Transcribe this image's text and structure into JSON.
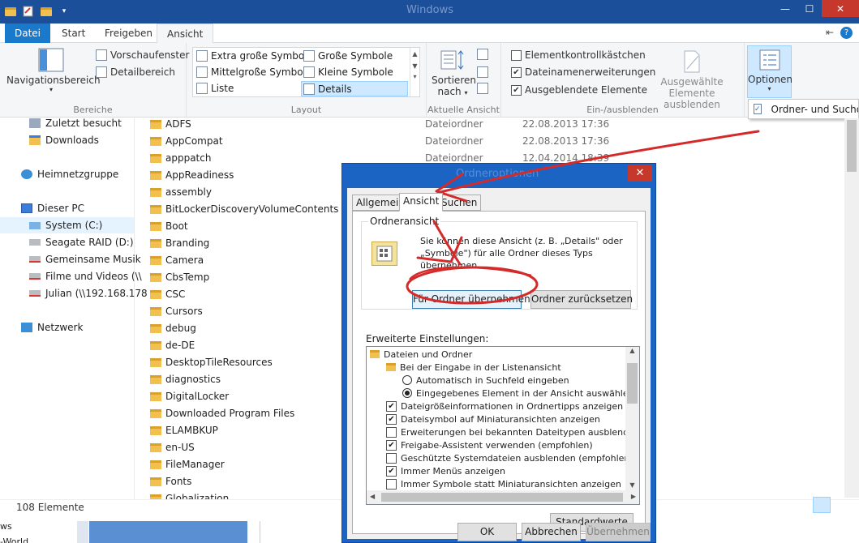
{
  "window": {
    "title": "Windows",
    "controls": {
      "minimize": "—",
      "maximize": "☐",
      "close": "✕"
    }
  },
  "ribbon": {
    "tabs": [
      {
        "label": "Datei"
      },
      {
        "label": "Start"
      },
      {
        "label": "Freigeben"
      },
      {
        "label": "Ansicht"
      }
    ],
    "groups": {
      "bereiche": {
        "label": "Bereiche",
        "navigationsbereich": "Navigationsbereich",
        "vorschaufenster": "Vorschaufenster",
        "detailbereich": "Detailbereich"
      },
      "layout": {
        "label": "Layout",
        "items": [
          "Extra große Symbole",
          "Große Symbole",
          "Mittelgroße Symbole",
          "Kleine Symbole",
          "Liste",
          "Details"
        ]
      },
      "aktuelle_ansicht": {
        "label": "Aktuelle Ansicht",
        "sortieren": "Sortieren",
        "nach": "nach"
      },
      "ein_ausblenden": {
        "label": "Ein-/ausblenden",
        "elementkontrollkaestchen": "Elementkontrollkästchen",
        "dateinamenerweiterungen": "Dateinamenerweiterungen",
        "ausgeblendete_elemente": "Ausgeblendete Elemente",
        "ausgewaehlte_line1": "Ausgewählte",
        "ausgewaehlte_line2": "Elemente ausblenden"
      },
      "optionen": {
        "label": "Optionen"
      }
    },
    "options_menu_item": "Ordner- und Suchop"
  },
  "nav": {
    "items": [
      {
        "label": "Zuletzt besucht",
        "icon": "recent-icon"
      },
      {
        "label": "Downloads",
        "icon": "downloads-icon"
      },
      {
        "label": "Heimnetzgruppe",
        "icon": "homegroup-icon"
      },
      {
        "label": "Dieser PC",
        "icon": "computer-icon"
      },
      {
        "label": "System (C:)",
        "icon": "drive-icon"
      },
      {
        "label": "Seagate RAID (D:)",
        "icon": "drive-icon"
      },
      {
        "label": "Gemeinsame Musik",
        "icon": "network-drive-icon"
      },
      {
        "label": "Filme und Videos (\\\\",
        "icon": "network-drive-icon"
      },
      {
        "label": "Julian (\\\\192.168.178",
        "icon": "network-drive-icon"
      },
      {
        "label": "Netzwerk",
        "icon": "network-icon"
      }
    ]
  },
  "files": [
    {
      "name": "ADFS",
      "type": "Dateiordner",
      "date": "22.08.2013 17:36"
    },
    {
      "name": "AppCompat",
      "type": "Dateiordner",
      "date": "22.08.2013 17:36"
    },
    {
      "name": "apppatch",
      "type": "Dateiordner",
      "date": "12.04.2014 18:39"
    },
    {
      "name": "AppReadiness",
      "type": "",
      "date": ""
    },
    {
      "name": "assembly",
      "type": "",
      "date": ""
    },
    {
      "name": "BitLockerDiscoveryVolumeContents",
      "type": "",
      "date": ""
    },
    {
      "name": "Boot",
      "type": "",
      "date": ""
    },
    {
      "name": "Branding",
      "type": "",
      "date": ""
    },
    {
      "name": "Camera",
      "type": "",
      "date": ""
    },
    {
      "name": "CbsTemp",
      "type": "",
      "date": ""
    },
    {
      "name": "CSC",
      "type": "",
      "date": ""
    },
    {
      "name": "Cursors",
      "type": "",
      "date": ""
    },
    {
      "name": "debug",
      "type": "",
      "date": ""
    },
    {
      "name": "de-DE",
      "type": "",
      "date": ""
    },
    {
      "name": "DesktopTileResources",
      "type": "",
      "date": ""
    },
    {
      "name": "diagnostics",
      "type": "",
      "date": ""
    },
    {
      "name": "DigitalLocker",
      "type": "",
      "date": ""
    },
    {
      "name": "Downloaded Program Files",
      "type": "",
      "date": ""
    },
    {
      "name": "ELAMBKUP",
      "type": "",
      "date": ""
    },
    {
      "name": "en-US",
      "type": "",
      "date": ""
    },
    {
      "name": "FileManager",
      "type": "",
      "date": ""
    },
    {
      "name": "Fonts",
      "type": "",
      "date": ""
    },
    {
      "name": "Globalization",
      "type": "",
      "date": ""
    }
  ],
  "status": {
    "count": "108 Elemente"
  },
  "bottom": {
    "line1": "ws",
    "line2": "-World"
  },
  "dialog": {
    "title": "Ordneroptionen",
    "tabs": [
      "Allgemein",
      "Ansicht",
      "Suchen"
    ],
    "folder_views_legend": "Ordneransicht",
    "folder_views_text": "Sie können diese Ansicht (z. B. „Details\" oder „Symbole\") für alle Ordner dieses Typs übernehmen.",
    "apply_button": "Für Ordner übernehmen",
    "reset_button": "Ordner zurücksetzen",
    "advanced_label": "Erweiterte Einstellungen:",
    "tree": [
      {
        "kind": "folder",
        "label": "Dateien und Ordner",
        "indent": 0
      },
      {
        "kind": "folder",
        "label": "Bei der Eingabe in der Listenansicht",
        "indent": 1
      },
      {
        "kind": "radio",
        "checked": false,
        "label": "Automatisch in Suchfeld eingeben",
        "indent": 2
      },
      {
        "kind": "radio",
        "checked": true,
        "label": "Eingegebenes Element in der Ansicht auswählen",
        "indent": 2
      },
      {
        "kind": "check",
        "checked": true,
        "label": "Dateigrößeinformationen in Ordnertipps anzeigen",
        "indent": 1
      },
      {
        "kind": "check",
        "checked": true,
        "label": "Dateisymbol auf Miniaturansichten anzeigen",
        "indent": 1
      },
      {
        "kind": "check",
        "checked": false,
        "label": "Erweiterungen bei bekannten Dateitypen ausblenden",
        "indent": 1
      },
      {
        "kind": "check",
        "checked": true,
        "label": "Freigabe-Assistent verwenden (empfohlen)",
        "indent": 1
      },
      {
        "kind": "check",
        "checked": false,
        "label": "Geschützte Systemdateien ausblenden (empfohlen)",
        "indent": 1
      },
      {
        "kind": "check",
        "checked": true,
        "label": "Immer Menüs anzeigen",
        "indent": 1
      },
      {
        "kind": "check",
        "checked": false,
        "label": "Immer Symbole statt Miniaturansichten anzeigen",
        "indent": 1
      }
    ],
    "defaults_button": "Standardwerte",
    "ok_button": "OK",
    "cancel_button": "Abbrechen",
    "apply_disabled_button": "Übernehmen"
  },
  "colors": {
    "accent": "#1979ca",
    "annotation": "#d42a2a",
    "titlebar": "#1b4f9a",
    "close": "#c7382c"
  }
}
